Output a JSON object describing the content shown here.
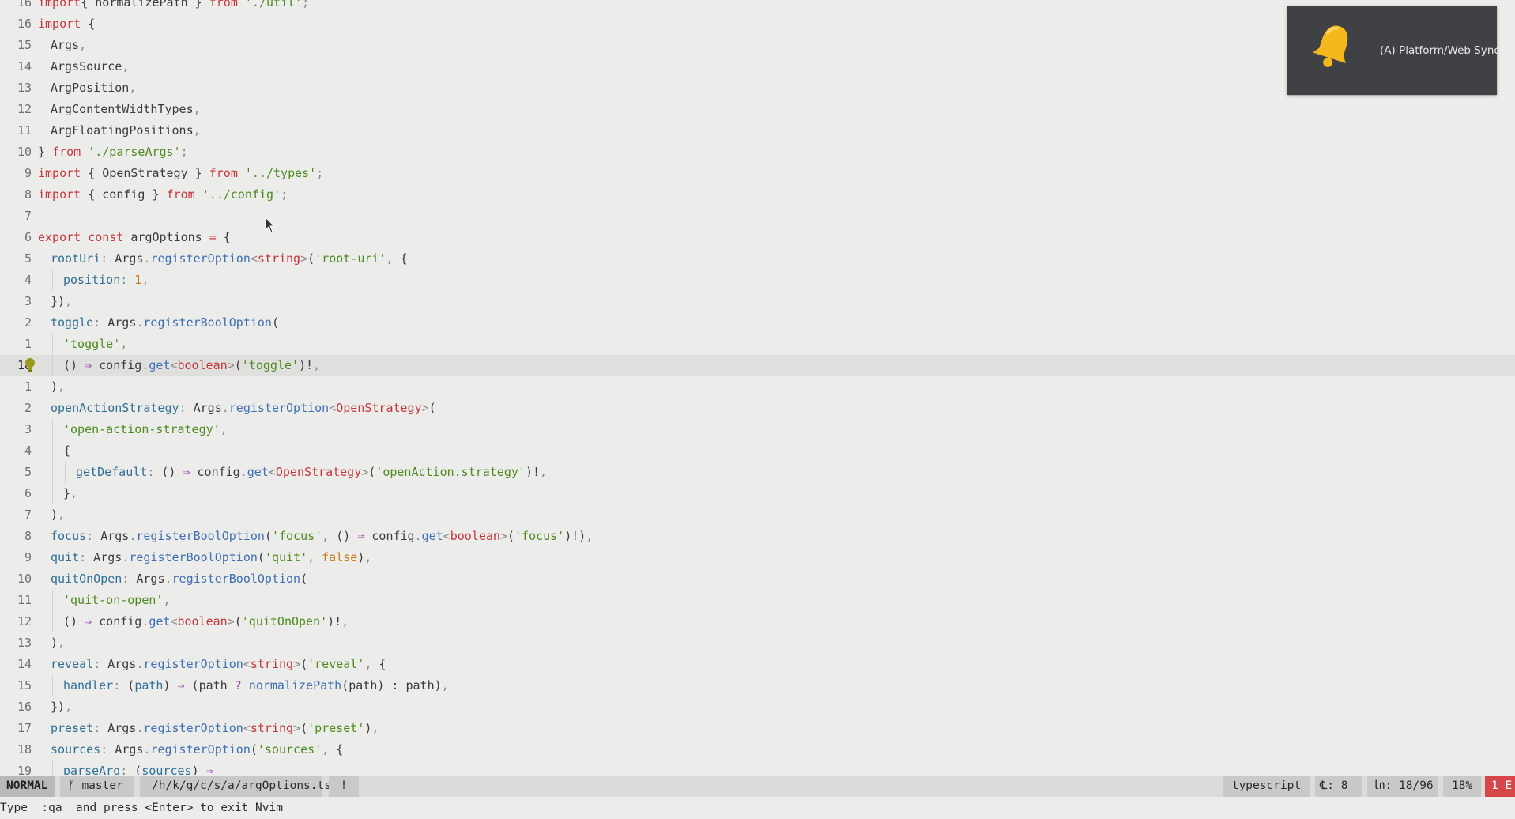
{
  "editor": {
    "lines": [
      {
        "ln": "16",
        "indent": 0,
        "tokens": [
          [
            "k",
            "import"
          ],
          [
            "",
            "{ "
          ],
          [
            "",
            "normalizePath"
          ],
          [
            "",
            " } "
          ],
          [
            "k",
            "from"
          ],
          [
            "",
            ""
          ],
          [
            "s",
            " './util'"
          ],
          [
            "pu",
            ";"
          ]
        ]
      },
      {
        "ln": "16",
        "indent": 0,
        "tokens": [
          [
            "k",
            "import"
          ],
          [
            "",
            " {"
          ]
        ]
      },
      {
        "ln": "15",
        "indent": 1,
        "tokens": [
          [
            "",
            "Args"
          ],
          [
            "pu",
            ","
          ]
        ]
      },
      {
        "ln": "14",
        "indent": 1,
        "tokens": [
          [
            "",
            "ArgsSource"
          ],
          [
            "pu",
            ","
          ]
        ]
      },
      {
        "ln": "13",
        "indent": 1,
        "tokens": [
          [
            "",
            "ArgPosition"
          ],
          [
            "pu",
            ","
          ]
        ]
      },
      {
        "ln": "12",
        "indent": 1,
        "tokens": [
          [
            "",
            "ArgContentWidthTypes"
          ],
          [
            "pu",
            ","
          ]
        ]
      },
      {
        "ln": "11",
        "indent": 1,
        "tokens": [
          [
            "",
            "ArgFloatingPositions"
          ],
          [
            "pu",
            ","
          ]
        ]
      },
      {
        "ln": "10",
        "indent": 0,
        "tokens": [
          [
            "",
            "} "
          ],
          [
            "k",
            "from"
          ],
          [
            "s",
            " './parseArgs'"
          ],
          [
            "pu",
            ";"
          ]
        ]
      },
      {
        "ln": "9",
        "indent": 0,
        "tokens": [
          [
            "k",
            "import"
          ],
          [
            "",
            " { OpenStrategy } "
          ],
          [
            "k",
            "from"
          ],
          [
            "s",
            " '../types'"
          ],
          [
            "pu",
            ";"
          ]
        ]
      },
      {
        "ln": "8",
        "indent": 0,
        "tokens": [
          [
            "k",
            "import"
          ],
          [
            "",
            " { config } "
          ],
          [
            "k",
            "from"
          ],
          [
            "s",
            " '../config'"
          ],
          [
            "pu",
            ";"
          ]
        ]
      },
      {
        "ln": "7",
        "indent": 0,
        "tokens": []
      },
      {
        "ln": "6",
        "indent": 0,
        "tokens": [
          [
            "k",
            "export const"
          ],
          [
            "",
            " argOptions "
          ],
          [
            "k",
            "="
          ],
          [
            "",
            " {"
          ]
        ]
      },
      {
        "ln": "5",
        "indent": 1,
        "tokens": [
          [
            "p",
            "rootUri"
          ],
          [
            "pu",
            ":"
          ],
          [
            "",
            " Args"
          ],
          [
            "pu",
            "."
          ],
          [
            "f",
            "registerOption"
          ],
          [
            "pu",
            "<"
          ],
          [
            "t",
            "string"
          ],
          [
            "pu",
            ">"
          ],
          [
            "",
            "("
          ],
          [
            "s",
            "'root-uri'"
          ],
          [
            "pu",
            ","
          ],
          [
            "",
            " {"
          ]
        ]
      },
      {
        "ln": "4",
        "indent": 2,
        "tokens": [
          [
            "p",
            "position"
          ],
          [
            "pu",
            ":"
          ],
          [
            "n",
            " 1"
          ],
          [
            "pu",
            ","
          ]
        ]
      },
      {
        "ln": "3",
        "indent": 1,
        "tokens": [
          [
            "",
            "})"
          ],
          [
            "pu",
            ","
          ]
        ]
      },
      {
        "ln": "2",
        "indent": 1,
        "tokens": [
          [
            "p",
            "toggle"
          ],
          [
            "pu",
            ":"
          ],
          [
            "",
            " Args"
          ],
          [
            "pu",
            "."
          ],
          [
            "f",
            "registerBoolOption"
          ],
          [
            "",
            "("
          ]
        ]
      },
      {
        "ln": "1",
        "indent": 2,
        "tokens": [
          [
            "s",
            "'toggle'"
          ],
          [
            "pu",
            ","
          ]
        ]
      },
      {
        "ln": "18",
        "indent": 2,
        "current": true,
        "tokens": [
          [
            "",
            "() "
          ],
          [
            "o",
            "⇒"
          ],
          [
            "",
            " config"
          ],
          [
            "pu",
            "."
          ],
          [
            "f",
            "get"
          ],
          [
            "pu",
            "<"
          ],
          [
            "t",
            "boolean"
          ],
          [
            "pu",
            ">"
          ],
          [
            "",
            "("
          ],
          [
            "s",
            "'toggle'"
          ],
          [
            "",
            ")!"
          ],
          [
            "pu",
            ","
          ]
        ]
      },
      {
        "ln": "1",
        "indent": 1,
        "tokens": [
          [
            "",
            ")"
          ],
          [
            "pu",
            ","
          ]
        ]
      },
      {
        "ln": "2",
        "indent": 1,
        "tokens": [
          [
            "p",
            "openActionStrategy"
          ],
          [
            "pu",
            ":"
          ],
          [
            "",
            " Args"
          ],
          [
            "pu",
            "."
          ],
          [
            "f",
            "registerOption"
          ],
          [
            "pu",
            "<"
          ],
          [
            "t",
            "OpenStrategy"
          ],
          [
            "pu",
            ">"
          ],
          [
            "",
            "("
          ]
        ]
      },
      {
        "ln": "3",
        "indent": 2,
        "tokens": [
          [
            "s",
            "'open-action-strategy'"
          ],
          [
            "pu",
            ","
          ]
        ]
      },
      {
        "ln": "4",
        "indent": 2,
        "tokens": [
          [
            "",
            "{"
          ]
        ]
      },
      {
        "ln": "5",
        "indent": 3,
        "tokens": [
          [
            "p",
            "getDefault"
          ],
          [
            "pu",
            ":"
          ],
          [
            "",
            " () "
          ],
          [
            "o",
            "⇒"
          ],
          [
            "",
            " config"
          ],
          [
            "pu",
            "."
          ],
          [
            "f",
            "get"
          ],
          [
            "pu",
            "<"
          ],
          [
            "t",
            "OpenStrategy"
          ],
          [
            "pu",
            ">"
          ],
          [
            "",
            "("
          ],
          [
            "s",
            "'openAction.strategy'"
          ],
          [
            "",
            ")!"
          ],
          [
            "pu",
            ","
          ]
        ]
      },
      {
        "ln": "6",
        "indent": 2,
        "tokens": [
          [
            "",
            "}"
          ],
          [
            "pu",
            ","
          ]
        ]
      },
      {
        "ln": "7",
        "indent": 1,
        "tokens": [
          [
            "",
            ")"
          ],
          [
            "pu",
            ","
          ]
        ]
      },
      {
        "ln": "8",
        "indent": 1,
        "tokens": [
          [
            "p",
            "focus"
          ],
          [
            "pu",
            ":"
          ],
          [
            "",
            " Args"
          ],
          [
            "pu",
            "."
          ],
          [
            "f",
            "registerBoolOption"
          ],
          [
            "",
            "("
          ],
          [
            "s",
            "'focus'"
          ],
          [
            "pu",
            ","
          ],
          [
            "",
            " () "
          ],
          [
            "o",
            "⇒"
          ],
          [
            "",
            " config"
          ],
          [
            "pu",
            "."
          ],
          [
            "f",
            "get"
          ],
          [
            "pu",
            "<"
          ],
          [
            "t",
            "boolean"
          ],
          [
            "pu",
            ">"
          ],
          [
            "",
            "("
          ],
          [
            "s",
            "'focus'"
          ],
          [
            "",
            ")!)"
          ],
          [
            "pu",
            ","
          ]
        ]
      },
      {
        "ln": "9",
        "indent": 1,
        "tokens": [
          [
            "p",
            "quit"
          ],
          [
            "pu",
            ":"
          ],
          [
            "",
            " Args"
          ],
          [
            "pu",
            "."
          ],
          [
            "f",
            "registerBoolOption"
          ],
          [
            "",
            "("
          ],
          [
            "s",
            "'quit'"
          ],
          [
            "pu",
            ","
          ],
          [
            "n",
            " false"
          ],
          [
            "",
            ")"
          ],
          [
            "pu",
            ","
          ]
        ]
      },
      {
        "ln": "10",
        "indent": 1,
        "tokens": [
          [
            "p",
            "quitOnOpen"
          ],
          [
            "pu",
            ":"
          ],
          [
            "",
            " Args"
          ],
          [
            "pu",
            "."
          ],
          [
            "f",
            "registerBoolOption"
          ],
          [
            "",
            "("
          ]
        ]
      },
      {
        "ln": "11",
        "indent": 2,
        "tokens": [
          [
            "s",
            "'quit-on-open'"
          ],
          [
            "pu",
            ","
          ]
        ]
      },
      {
        "ln": "12",
        "indent": 2,
        "tokens": [
          [
            "",
            "() "
          ],
          [
            "o",
            "⇒"
          ],
          [
            "",
            " config"
          ],
          [
            "pu",
            "."
          ],
          [
            "f",
            "get"
          ],
          [
            "pu",
            "<"
          ],
          [
            "t",
            "boolean"
          ],
          [
            "pu",
            ">"
          ],
          [
            "",
            "("
          ],
          [
            "s",
            "'quitOnOpen'"
          ],
          [
            "",
            ")!"
          ],
          [
            "pu",
            ","
          ]
        ]
      },
      {
        "ln": "13",
        "indent": 1,
        "tokens": [
          [
            "",
            ")"
          ],
          [
            "pu",
            ","
          ]
        ]
      },
      {
        "ln": "14",
        "indent": 1,
        "tokens": [
          [
            "p",
            "reveal"
          ],
          [
            "pu",
            ":"
          ],
          [
            "",
            " Args"
          ],
          [
            "pu",
            "."
          ],
          [
            "f",
            "registerOption"
          ],
          [
            "pu",
            "<"
          ],
          [
            "t",
            "string"
          ],
          [
            "pu",
            ">"
          ],
          [
            "",
            "("
          ],
          [
            "s",
            "'reveal'"
          ],
          [
            "pu",
            ","
          ],
          [
            "",
            " {"
          ]
        ]
      },
      {
        "ln": "15",
        "indent": 2,
        "tokens": [
          [
            "p",
            "handler"
          ],
          [
            "pu",
            ":"
          ],
          [
            "",
            " ("
          ],
          [
            "p",
            "path"
          ],
          [
            "",
            ") "
          ],
          [
            "o",
            "⇒"
          ],
          [
            "",
            " (path "
          ],
          [
            "o",
            "?"
          ],
          [
            "",
            " "
          ],
          [
            "f",
            "normalizePath"
          ],
          [
            "",
            "(path) : path)"
          ],
          [
            "pu",
            ","
          ]
        ]
      },
      {
        "ln": "16",
        "indent": 1,
        "tokens": [
          [
            "",
            "})"
          ],
          [
            "pu",
            ","
          ]
        ]
      },
      {
        "ln": "17",
        "indent": 1,
        "tokens": [
          [
            "p",
            "preset"
          ],
          [
            "pu",
            ":"
          ],
          [
            "",
            " Args"
          ],
          [
            "pu",
            "."
          ],
          [
            "f",
            "registerOption"
          ],
          [
            "pu",
            "<"
          ],
          [
            "t",
            "string"
          ],
          [
            "pu",
            ">"
          ],
          [
            "",
            "("
          ],
          [
            "s",
            "'preset'"
          ],
          [
            "",
            ")"
          ],
          [
            "pu",
            ","
          ]
        ]
      },
      {
        "ln": "18",
        "indent": 1,
        "tokens": [
          [
            "p",
            "sources"
          ],
          [
            "pu",
            ":"
          ],
          [
            "",
            " Args"
          ],
          [
            "pu",
            "."
          ],
          [
            "f",
            "registerOption"
          ],
          [
            "",
            "("
          ],
          [
            "s",
            "'sources'"
          ],
          [
            "pu",
            ","
          ],
          [
            "",
            " {"
          ]
        ]
      },
      {
        "ln": "19",
        "indent": 2,
        "tokens": [
          [
            "p",
            "parseArg"
          ],
          [
            "pu",
            ":"
          ],
          [
            "",
            " ("
          ],
          [
            "p",
            "sources"
          ],
          [
            "",
            ") "
          ],
          [
            "o",
            "⇒"
          ]
        ]
      }
    ]
  },
  "notification": {
    "text": "(A) Platform/Web Sync",
    "icon": "bell-icon",
    "bell_color": "#f5b81c"
  },
  "statusline": {
    "mode": "NORMAL",
    "branch_icon": "git-branch-icon",
    "branch": "master",
    "filepath": "/h/k/g/c/s/a/argOptions.ts",
    "modified": "!",
    "filetype": "typescript",
    "col_label": "℄: 8",
    "line_label": "㏑: 18/96",
    "percent": "18%",
    "errors": "1 E"
  },
  "cmdline": "Type  :qa  and press <Enter> to exit Nvim"
}
